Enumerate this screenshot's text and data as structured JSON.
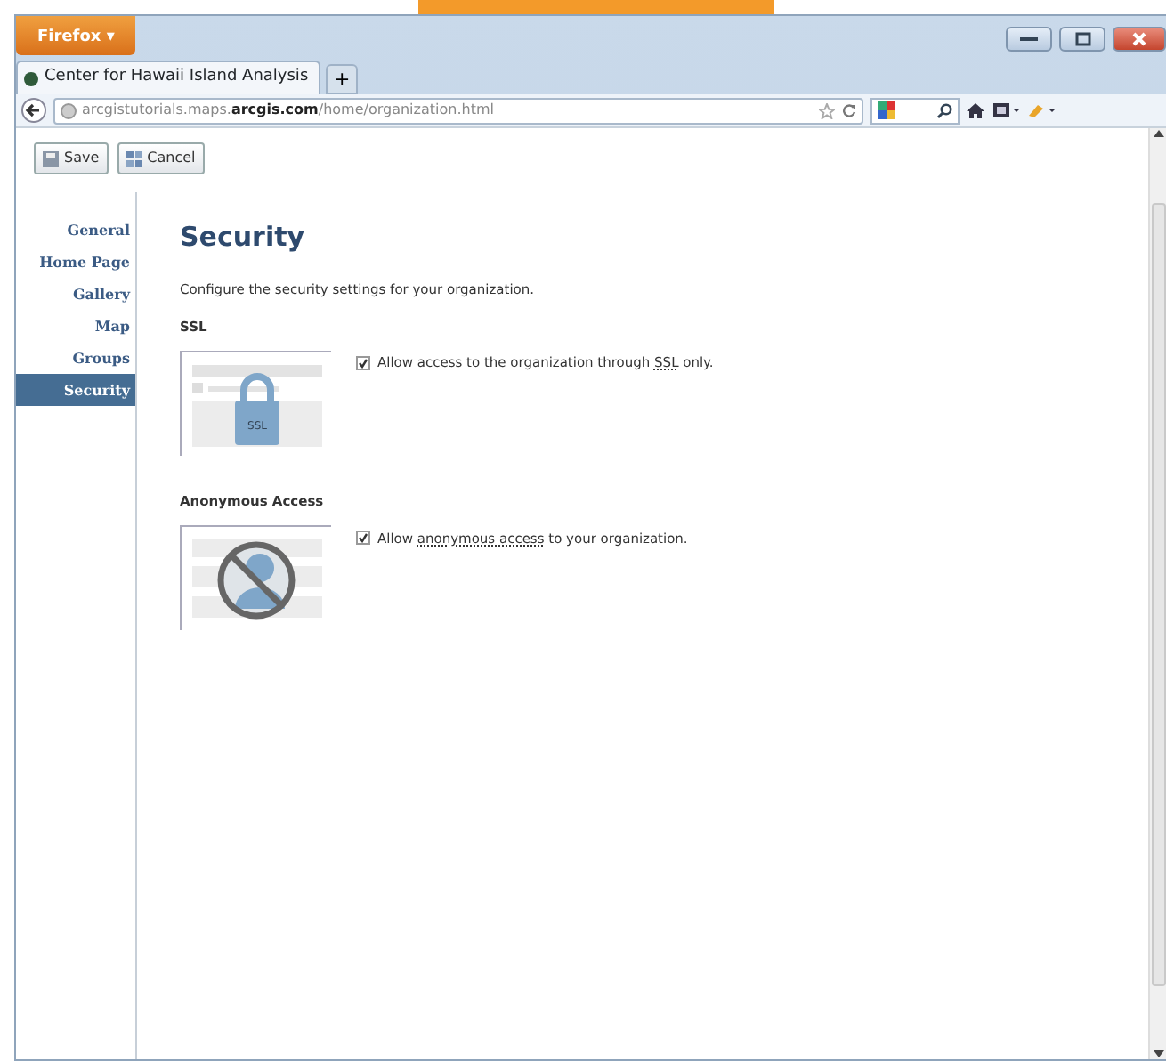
{
  "browser": {
    "menu_button": "Firefox ▾",
    "tabs": [
      {
        "label": "Center for Hawaii Island Analysis",
        "selected": true
      }
    ],
    "new_tab": "+",
    "url_parts": [
      {
        "text": "arcgistutorials.maps.",
        "kind": "plain"
      },
      {
        "text": "arcgis.com",
        "kind": "domain"
      },
      {
        "text": "/home/organization.html",
        "kind": "plain"
      }
    ]
  },
  "toolbar": {
    "buttons": [
      {
        "label": "Save",
        "kind": "save"
      },
      {
        "label": "Cancel",
        "kind": "cancel"
      }
    ]
  },
  "sidebar": {
    "items": [
      {
        "label": "General",
        "selected": false
      },
      {
        "label": "Home Page",
        "selected": false
      },
      {
        "label": "Gallery",
        "selected": false
      },
      {
        "label": "Map",
        "selected": false
      },
      {
        "label": "Groups",
        "selected": false
      },
      {
        "label": "Security",
        "selected": true
      }
    ]
  },
  "page": {
    "title": "Security",
    "description": "Configure the security settings for your organization.",
    "sections": [
      {
        "title": "SSL",
        "illustration": {
          "kind": "lock",
          "text": "SSL"
        },
        "checked": true,
        "parts": [
          {
            "text": "Allow access to the organization through ",
            "underlined": false
          },
          {
            "text": "SSL",
            "underlined": true
          },
          {
            "text": " only.",
            "underlined": false
          }
        ]
      },
      {
        "title": "Anonymous Access",
        "illustration": {
          "kind": "anonymous"
        },
        "checked": true,
        "parts": [
          {
            "text": "Allow ",
            "underlined": false
          },
          {
            "text": "anonymous access",
            "underlined": true
          },
          {
            "text": " to your organization.",
            "underlined": false
          }
        ]
      }
    ]
  }
}
